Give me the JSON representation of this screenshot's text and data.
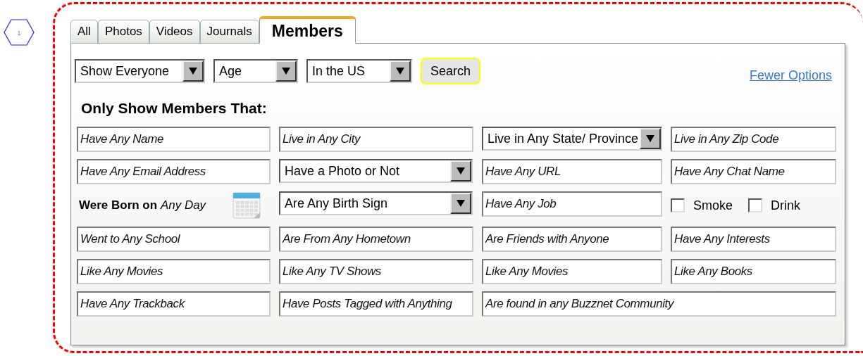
{
  "marker": "1",
  "tabs": [
    {
      "label": "All",
      "selected": false
    },
    {
      "label": "Photos",
      "selected": false
    },
    {
      "label": "Videos",
      "selected": false
    },
    {
      "label": "Journals",
      "selected": false
    },
    {
      "label": "Members",
      "selected": true
    }
  ],
  "filters": [
    {
      "value": "Show Everyone"
    },
    {
      "value": "Age"
    },
    {
      "value": "In the US"
    }
  ],
  "search_button": "Search",
  "fewer_options_link": "Fewer Options",
  "heading": "Only Show Members That:",
  "rows": [
    [
      {
        "kind": "input",
        "placeholder": "Have Any Name"
      },
      {
        "kind": "input",
        "placeholder": "Live in Any City"
      },
      {
        "kind": "select",
        "value": "Live in Any State/ Province"
      },
      {
        "kind": "input",
        "placeholder": "Live in Any Zip Code"
      }
    ],
    [
      {
        "kind": "input",
        "placeholder": "Have Any Email Address"
      },
      {
        "kind": "select",
        "value": "Have a Photo or Not"
      },
      {
        "kind": "input",
        "placeholder": "Have Any URL"
      },
      {
        "kind": "input",
        "placeholder": "Have Any Chat Name"
      }
    ],
    [
      {
        "kind": "date",
        "label": "**Were Born on** *Any Day*"
      },
      {
        "kind": "select",
        "value": "Are Any Birth Sign"
      },
      {
        "kind": "input",
        "placeholder": "Have Any Job"
      },
      {
        "kind": "checks",
        "options": [
          {
            "label": "Smoke",
            "checked": false
          },
          {
            "label": "Drink",
            "checked": false
          }
        ]
      }
    ],
    [
      {
        "kind": "input",
        "placeholder": "Went to Any School"
      },
      {
        "kind": "input",
        "placeholder": "Are From Any Hometown"
      },
      {
        "kind": "input",
        "placeholder": "Are Friends with Anyone"
      },
      {
        "kind": "input",
        "placeholder": "Have Any Interests"
      }
    ],
    [
      {
        "kind": "input",
        "placeholder": "Like Any Movies"
      },
      {
        "kind": "input",
        "placeholder": "Like Any TV Shows"
      },
      {
        "kind": "input",
        "placeholder": "Like Any Movies"
      },
      {
        "kind": "input",
        "placeholder": "Like Any Books"
      }
    ],
    [
      {
        "kind": "input",
        "placeholder": "Have Any Trackback"
      },
      {
        "kind": "input",
        "placeholder": "Have Posts Tagged with Anything"
      },
      {
        "kind": "wide",
        "placeholder": "Are found in any Buzznet Community"
      }
    ]
  ]
}
